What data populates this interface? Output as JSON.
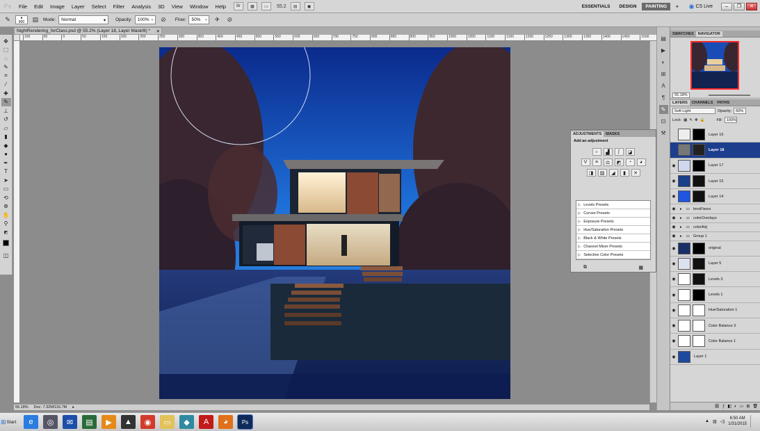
{
  "app": {
    "logo": "Ps",
    "menu": [
      "File",
      "Edit",
      "Image",
      "Layer",
      "Select",
      "Filter",
      "Analysis",
      "3D",
      "View",
      "Window",
      "Help"
    ],
    "zoom_readout": "55.2",
    "workspaces": [
      "ESSENTIALS",
      "DESIGN",
      "PAINTING"
    ],
    "active_workspace": "PAINTING",
    "more_workspaces_icon": "double-chevron-right-icon",
    "cs_live": "CS Live"
  },
  "options": {
    "brush_size": "800",
    "mode_label": "Mode:",
    "mode_value": "Normal",
    "opacity_label": "Opacity:",
    "opacity_value": "100%",
    "flow_label": "Flow:",
    "flow_value": "50%"
  },
  "document": {
    "tab_title": "NightRendering_forClass.psd @ 55.2% (Layer 18, Layer Mask/8) *",
    "status_zoom": "55.18%",
    "status_doc": "Doc: 7.32M/116.7M",
    "ruler_ticks": [
      "100",
      "50",
      "0",
      "50",
      "100",
      "150",
      "200",
      "250",
      "300",
      "350",
      "400",
      "450",
      "500",
      "550",
      "600",
      "650",
      "700",
      "750",
      "800",
      "850",
      "900",
      "950",
      "1000",
      "1050",
      "1100",
      "1150",
      "1200",
      "1250",
      "1300",
      "1350",
      "1400",
      "1450",
      "1500"
    ]
  },
  "navigator": {
    "tabs": [
      "SWATCHES",
      "NAVIGATOR"
    ],
    "active_tab": "NAVIGATOR",
    "zoom": "55.18%"
  },
  "layers_panel": {
    "tabs": [
      "LAYERS",
      "CHANNELS",
      "PATHS"
    ],
    "active_tab": "LAYERS",
    "blend_mode": "Soft Light",
    "opacity_label": "Opacity:",
    "opacity_value": "60%",
    "lock_label": "Lock:",
    "fill_label": "Fill:",
    "fill_value": "100%",
    "layers": [
      {
        "name": "Layer 16",
        "visible": false,
        "type": "layer",
        "thumb": "#eeeeee",
        "mask": "#000000"
      },
      {
        "name": "Layer 18",
        "visible": false,
        "type": "layer",
        "thumb": "#777777",
        "mask": "#222222",
        "active": true
      },
      {
        "name": "Layer 17",
        "visible": true,
        "type": "layer",
        "thumb": "#cfd8ee",
        "mask": "#000000"
      },
      {
        "name": "Layer 15",
        "visible": true,
        "type": "layer",
        "thumb": "#1a3f8a",
        "mask": "#111111"
      },
      {
        "name": "Layer 14",
        "visible": true,
        "type": "layer",
        "thumb": "#1f55e0",
        "mask": "#111111"
      },
      {
        "name": "lensFlares",
        "visible": true,
        "type": "group"
      },
      {
        "name": "colorOverlays",
        "visible": true,
        "type": "group"
      },
      {
        "name": "colorAdj",
        "visible": true,
        "type": "group"
      },
      {
        "name": "Group 1",
        "visible": true,
        "type": "group"
      },
      {
        "name": "original",
        "visible": true,
        "type": "layer",
        "thumb": "#1a2f66",
        "mask": "#000000"
      },
      {
        "name": "Layer 5",
        "visible": true,
        "type": "layer",
        "thumb": "#dde2ef",
        "mask": "#111111"
      },
      {
        "name": "Levels 3",
        "visible": true,
        "type": "adjustment",
        "thumb": "#ffffff",
        "mask": "#111111"
      },
      {
        "name": "Levels 1",
        "visible": true,
        "type": "adjustment",
        "thumb": "#ffffff",
        "mask": "#000000"
      },
      {
        "name": "Hue/Saturation 1",
        "visible": true,
        "type": "adjustment",
        "thumb": "#ffffff",
        "mask": "#ffffff"
      },
      {
        "name": "Color Balance 3",
        "visible": true,
        "type": "adjustment",
        "thumb": "#ffffff",
        "mask": "#ffffff"
      },
      {
        "name": "Color Balance 1",
        "visible": true,
        "type": "adjustment",
        "thumb": "#ffffff",
        "mask": "#ffffff"
      },
      {
        "name": "Layer 1",
        "visible": true,
        "type": "layer",
        "thumb": "#1e4a9e",
        "mask": null
      }
    ]
  },
  "adjustments_panel": {
    "tabs": [
      "ADJUSTMENTS",
      "MASKS"
    ],
    "active_tab": "ADJUSTMENTS",
    "title": "Add an adjustment",
    "presets": [
      "Levels Presets",
      "Curves Presets",
      "Exposure Presets",
      "Hue/Saturation Presets",
      "Black & White Presets",
      "Channel Mixer Presets",
      "Selective Color Presets"
    ]
  },
  "taskbar": {
    "start_label": "Start",
    "apps": [
      "ie-icon",
      "network-icon",
      "mail-icon",
      "media-icon",
      "vlc-icon",
      "reader-icon",
      "chrome-icon",
      "explorer-icon",
      "sketchup-icon",
      "acrobat-icon",
      "firefox-icon",
      "photoshop-icon"
    ],
    "ps_label": "Ps",
    "time": "6:50 AM",
    "date": "1/31/2015"
  }
}
